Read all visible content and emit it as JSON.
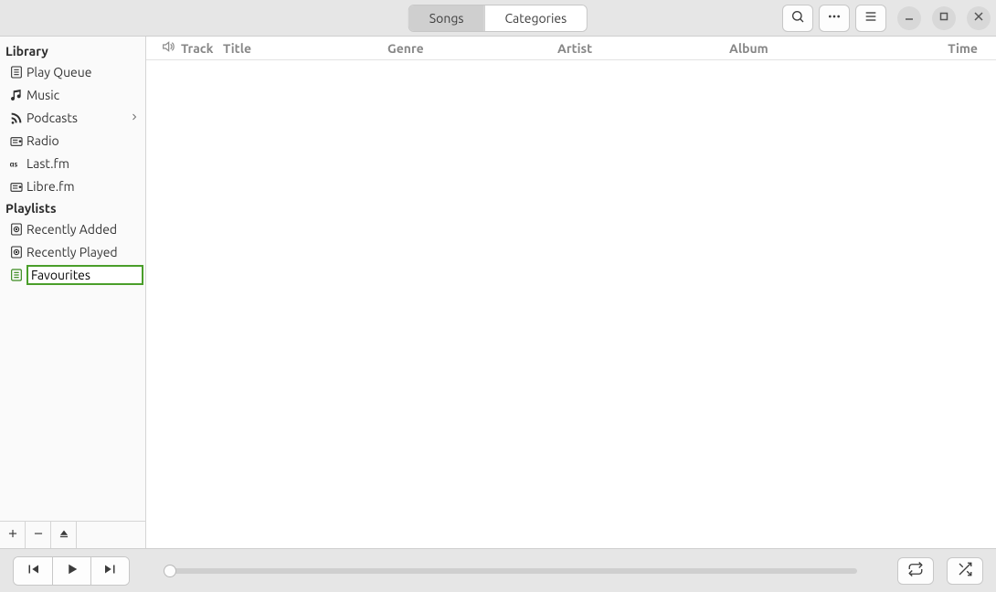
{
  "header": {
    "tabs": {
      "songs": "Songs",
      "categories": "Categories",
      "active": "songs"
    }
  },
  "sidebar": {
    "sections": {
      "library": {
        "title": "Library",
        "items": [
          {
            "label": "Play Queue",
            "icon": "playlist"
          },
          {
            "label": "Music",
            "icon": "music"
          },
          {
            "label": "Podcasts",
            "icon": "rss",
            "expandable": true
          },
          {
            "label": "Radio",
            "icon": "radio"
          },
          {
            "label": "Last.fm",
            "icon": "lastfm"
          },
          {
            "label": "Libre.fm",
            "icon": "radio"
          }
        ]
      },
      "playlists": {
        "title": "Playlists",
        "items": [
          {
            "label": "Recently Added",
            "icon": "auto-playlist"
          },
          {
            "label": "Recently Played",
            "icon": "auto-playlist"
          }
        ],
        "editing": {
          "value": "Favourites",
          "icon": "playlist"
        }
      }
    }
  },
  "columns": {
    "track": "Track",
    "title": "Title",
    "genre": "Genre",
    "artist": "Artist",
    "album": "Album",
    "time": "Time"
  }
}
